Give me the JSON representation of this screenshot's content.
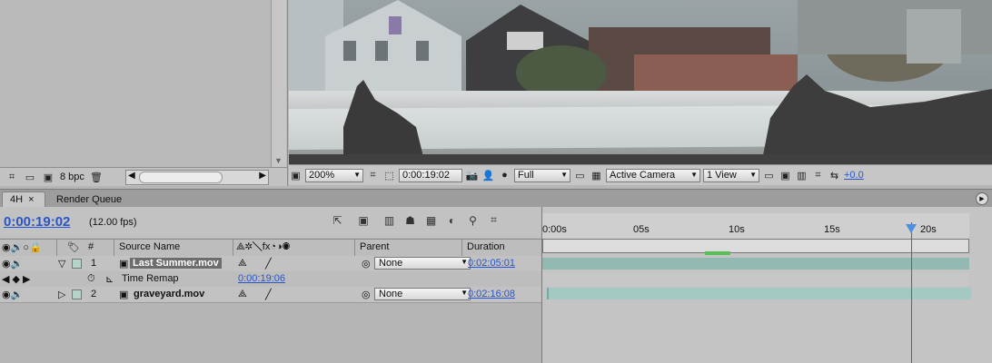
{
  "project": {
    "bit_depth": "8 bpc"
  },
  "viewer": {
    "zoom": "200%",
    "timecode": "0:00:19:02",
    "resolution": "Full",
    "camera": "Active Camera",
    "views": "1 View",
    "exposure": "+0.0"
  },
  "tabs": [
    {
      "label": "4H",
      "close": "×"
    },
    {
      "label": "Render Queue"
    }
  ],
  "timeline": {
    "current_time": "0:00:19:02",
    "fps": "(12.00 fps)",
    "columns": {
      "number": "#",
      "source_name": "Source Name",
      "parent": "Parent",
      "duration": "Duration"
    },
    "ruler_ticks": [
      "0:00s",
      "05s",
      "10s",
      "15s",
      "20s"
    ],
    "current_time_seconds": 19.17,
    "layers": [
      {
        "index": "1",
        "name": "Last Summer.mov",
        "parent": "None",
        "duration": "0:02:05:01",
        "expanded": true
      },
      {
        "index": "2",
        "name": "graveyard.mov",
        "parent": "None",
        "duration": "0:02:16:08",
        "expanded": false
      }
    ],
    "time_remap": {
      "label": "Time Remap",
      "value": "0:00:19:06"
    }
  },
  "colors": {
    "accent_blue": "#2a55c8",
    "cti_red": "#d4372a",
    "layer_bar": "#93b9b3"
  }
}
